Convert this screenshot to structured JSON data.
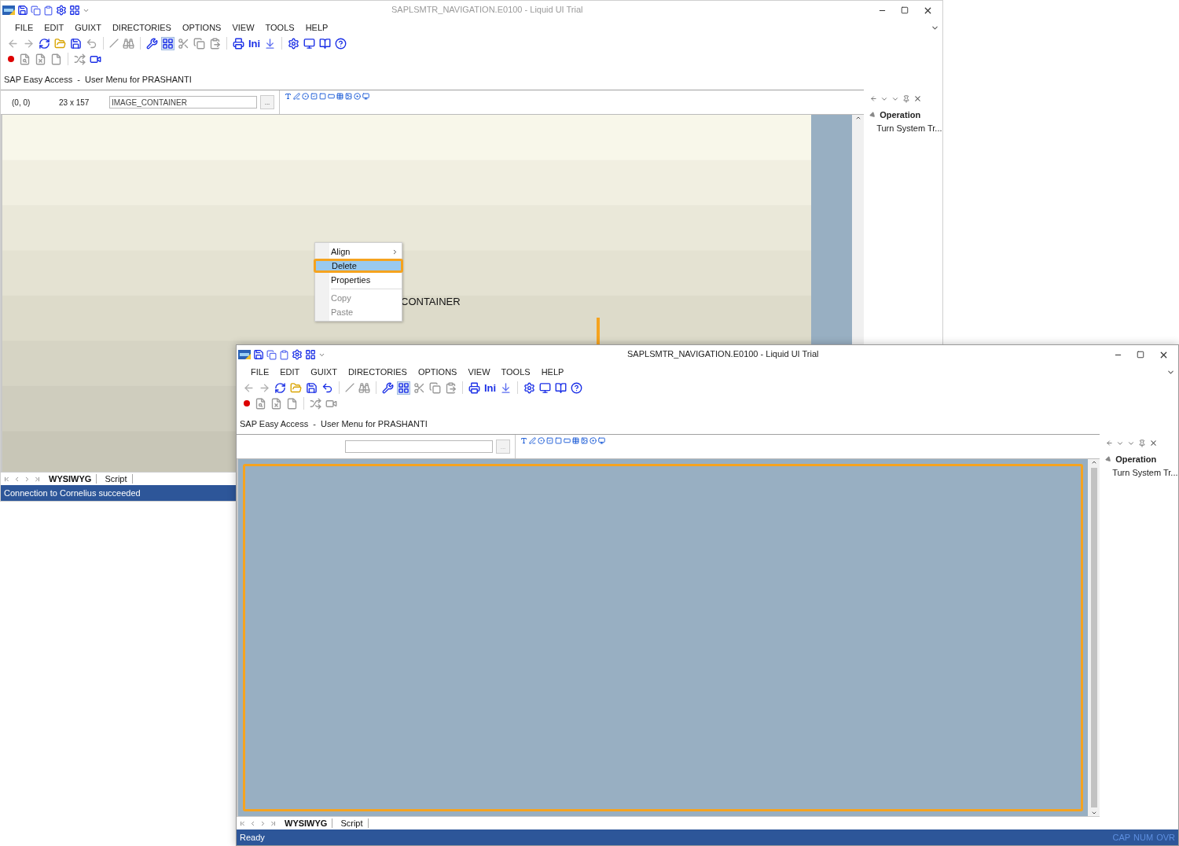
{
  "windows": [
    {
      "title": "SAPLSMTR_NAVIGATION.E0100 - Liquid UI Trial",
      "active": false,
      "menu": [
        "FILE",
        "EDIT",
        "GUIXT",
        "DIRECTORIES",
        "OPTIONS",
        "VIEW",
        "TOOLS",
        "HELP"
      ],
      "toolbar_text": "Ini",
      "breadcrumb": "SAP Easy Access  -  User Menu for PRASHANTI",
      "properties": {
        "position": "(0, 0)",
        "size": "23 x 157",
        "name": "IMAGE_CONTAINER",
        "browse": "..."
      },
      "canvas": {
        "label": "CONTAINER",
        "highlight": false
      },
      "context_menu": {
        "groups": [
          [
            {
              "label": "Align",
              "submenu": true,
              "disabled": false,
              "selected": false,
              "highlight": false
            },
            {
              "label": "Delete",
              "submenu": false,
              "disabled": false,
              "selected": true,
              "highlight": true
            },
            {
              "label": "Properties",
              "submenu": false,
              "disabled": false,
              "selected": false,
              "highlight": false
            }
          ],
          [
            {
              "label": "Copy",
              "submenu": false,
              "disabled": true,
              "selected": false,
              "highlight": false
            },
            {
              "label": "Paste",
              "submenu": false,
              "disabled": true,
              "selected": false,
              "highlight": false
            }
          ]
        ]
      },
      "tabs": [
        {
          "label": "WYSIWYG",
          "selected": true
        },
        {
          "label": "Script",
          "selected": false
        }
      ],
      "panel": {
        "tree": [
          {
            "label": "Operation",
            "expanded": true,
            "children": [
              {
                "label": "Turn System Tr..."
              }
            ]
          }
        ]
      },
      "status": {
        "message": "Connection to Cornelius succeeded"
      }
    },
    {
      "title": "SAPLSMTR_NAVIGATION.E0100 - Liquid UI Trial",
      "active": true,
      "menu": [
        "FILE",
        "EDIT",
        "GUIXT",
        "DIRECTORIES",
        "OPTIONS",
        "VIEW",
        "TOOLS",
        "HELP"
      ],
      "toolbar_text": "Ini",
      "breadcrumb": "SAP Easy Access  -  User Menu for PRASHANTI",
      "properties": {
        "browse": "..."
      },
      "canvas": {
        "kind": "empty",
        "highlight": true
      },
      "tabs": [
        {
          "label": "WYSIWYG",
          "selected": true
        },
        {
          "label": "Script",
          "selected": false
        }
      ],
      "panel": {
        "tree": [
          {
            "label": "Operation",
            "expanded": true,
            "children": [
              {
                "label": "Turn System Tr..."
              }
            ]
          }
        ]
      },
      "status": {
        "message": "Ready",
        "indicators": [
          "CAP",
          "NUM",
          "OVR"
        ]
      }
    }
  ]
}
